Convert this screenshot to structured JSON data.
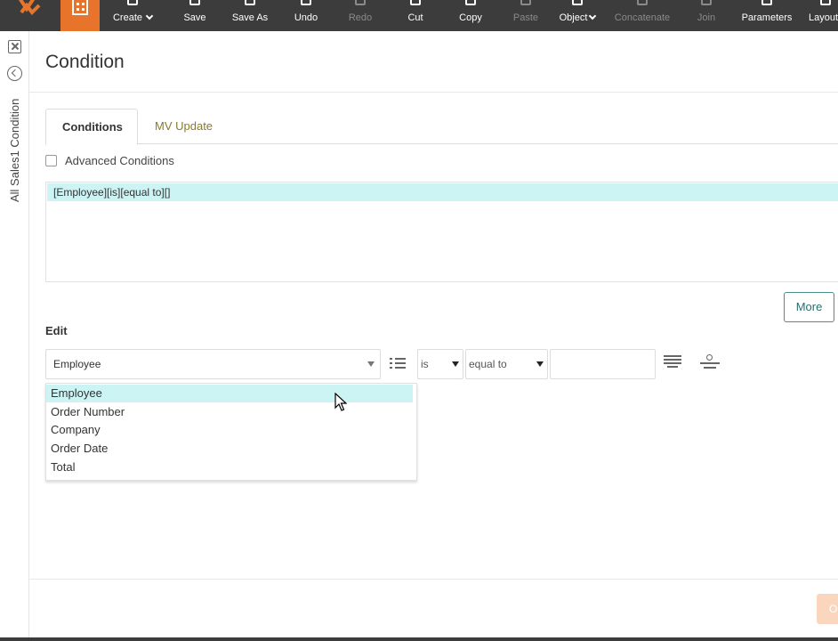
{
  "toolbar": {
    "items": [
      {
        "label": "Create",
        "icon": "create-icon",
        "dropdown": true,
        "disabled": false
      },
      {
        "label": "Save",
        "icon": "save-icon",
        "disabled": false
      },
      {
        "label": "Save As",
        "icon": "save-as-icon",
        "disabled": false
      },
      {
        "label": "Undo",
        "icon": "undo-icon",
        "disabled": false
      },
      {
        "label": "Redo",
        "icon": "redo-icon",
        "disabled": true
      },
      {
        "label": "Cut",
        "icon": "scissors-icon",
        "disabled": false
      },
      {
        "label": "Copy",
        "icon": "copy-icon",
        "disabled": false
      },
      {
        "label": "Paste",
        "icon": "paste-icon",
        "disabled": true
      },
      {
        "label": "Object",
        "icon": "object-icon",
        "dropdown": true,
        "disabled": false
      },
      {
        "label": "Concatenate",
        "icon": "concatenate-icon",
        "disabled": true
      },
      {
        "label": "Join",
        "icon": "join-icon",
        "disabled": true
      },
      {
        "label": "Parameters",
        "icon": "parameters-icon",
        "disabled": false
      },
      {
        "label": "Layout",
        "icon": "layout-icon",
        "disabled": false
      }
    ],
    "accent_color": "#e8742c"
  },
  "leftbar": {
    "title": "All Sales1 Condition"
  },
  "page": {
    "title": "Condition"
  },
  "tabs": [
    {
      "label": "Conditions",
      "active": true
    },
    {
      "label": "MV Update",
      "active": false
    }
  ],
  "advanced": {
    "label": "Advanced Conditions",
    "checked": false
  },
  "conditions": {
    "items": [
      "[Employee][is][equal to][]"
    ]
  },
  "more_button": {
    "label": "More"
  },
  "edit": {
    "label": "Edit",
    "field_value": "Employee",
    "operator_value": "is",
    "comparison_value": "equal to",
    "value_input": ""
  },
  "field_dropdown": {
    "options": [
      "Employee",
      "Order Number",
      "Company",
      "Order Date",
      "Total"
    ],
    "highlighted": "Employee"
  },
  "ok_button": {
    "label": "O"
  }
}
